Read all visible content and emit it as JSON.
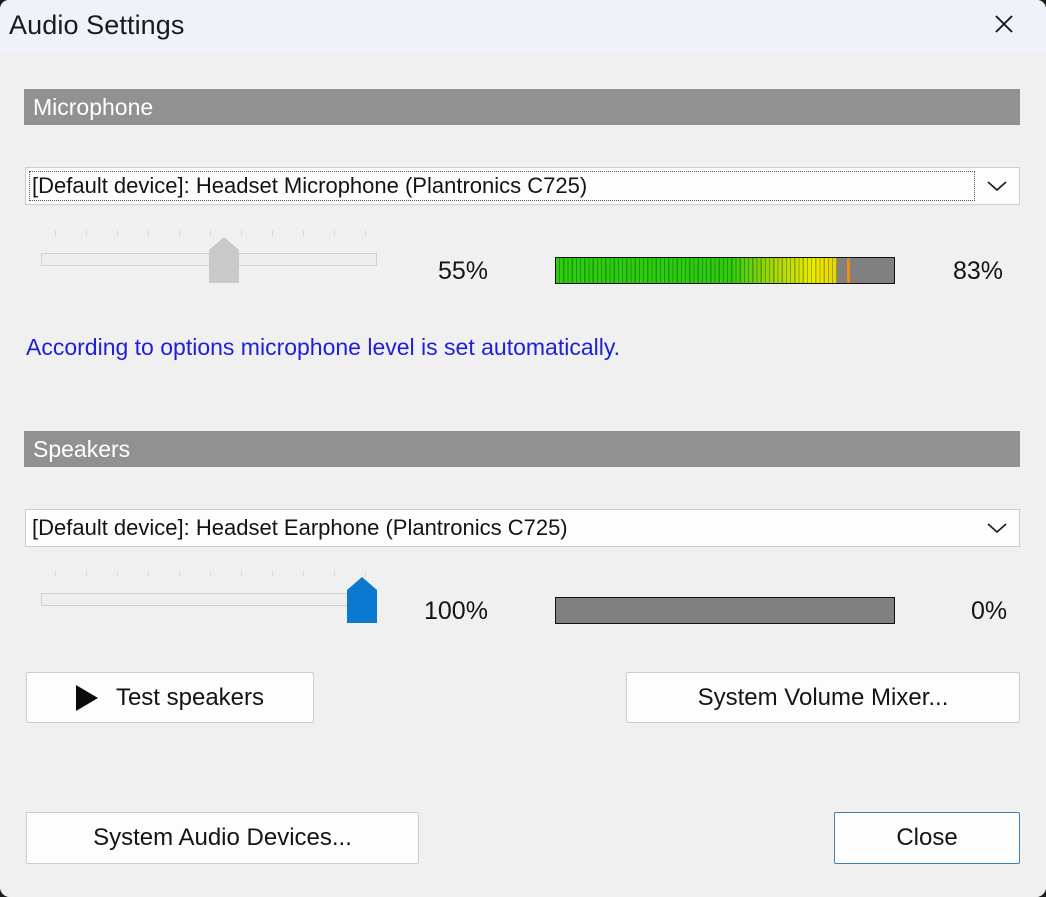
{
  "window": {
    "title": "Audio Settings",
    "close_icon": "close-icon"
  },
  "microphone": {
    "header": "Microphone",
    "device": "[Default device]: Headset Microphone (Plantronics C725)",
    "dropdown_icon": "chevron-down-icon",
    "volume_percent_label": "55%",
    "volume_value": 55,
    "level_percent_label": "83%",
    "level_value": 83,
    "peak_value": 86,
    "note": "According to options microphone level is set automatically.",
    "note_color": "#1f1fd8",
    "slider_disabled": true
  },
  "speakers": {
    "header": "Speakers",
    "device": "[Default device]: Headset Earphone (Plantronics C725)",
    "dropdown_icon": "chevron-down-icon",
    "volume_percent_label": "100%",
    "volume_value": 100,
    "level_percent_label": "0%",
    "level_value": 0,
    "thumb_color": "#0b79d0",
    "test_button": "Test speakers",
    "test_button_icon": "play-icon",
    "volume_mixer_button": "System Volume Mixer..."
  },
  "footer": {
    "system_audio_devices_button": "System Audio Devices...",
    "close_button": "Close",
    "close_button_accent": "#3f7fb5"
  },
  "colors": {
    "titlebar_bg": "#eff3f9",
    "dialog_bg": "#f0f0f0",
    "section_header_bg": "#919191",
    "meter_empty": "#808080",
    "meter_green": "#2ecc0e",
    "meter_yellow": "#ecec00",
    "meter_peak": "#ee8b12"
  }
}
